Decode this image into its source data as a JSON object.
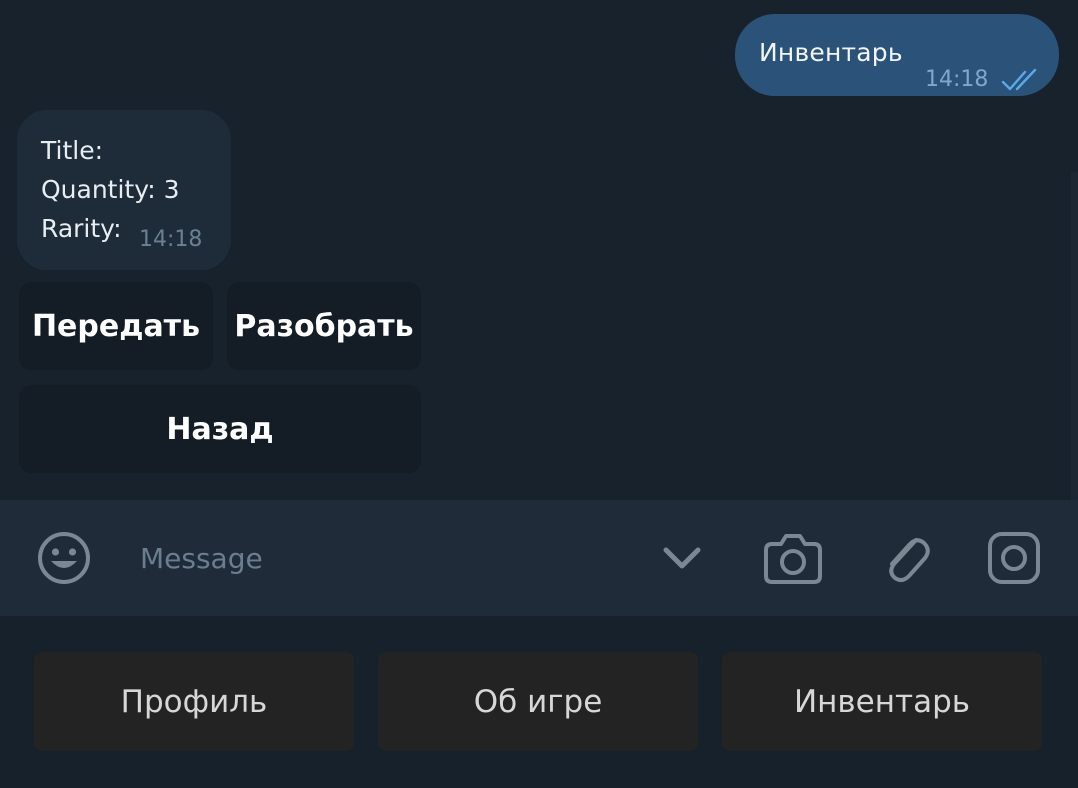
{
  "messages": {
    "outgoing": {
      "text": "Инвентарь",
      "time": "14:18",
      "status_icon": "double-check-icon"
    },
    "incoming": {
      "lines": [
        "Title:",
        "Quantity: 3",
        "Rarity:"
      ],
      "time": "14:18"
    }
  },
  "inline_keyboard": {
    "buttons": [
      "Передать",
      "Разобрать",
      "Назад"
    ]
  },
  "input": {
    "placeholder": "Message",
    "value": "",
    "icons": [
      "emoji-icon",
      "chevron-down-icon",
      "camera-icon",
      "paperclip-icon",
      "instagram-icon"
    ]
  },
  "reply_keyboard": {
    "buttons": [
      "Профиль",
      "Об игре",
      "Инвентарь"
    ]
  },
  "colors": {
    "background": "#17212b",
    "outgoing_bubble": "#2b5278",
    "incoming_bubble": "#1e2c3a",
    "inline_button": "#141d26",
    "input_bar": "#1f2b38",
    "reply_button": "#232323",
    "check_accent": "#5aa9ea",
    "icon_gray": "#7a8894"
  }
}
